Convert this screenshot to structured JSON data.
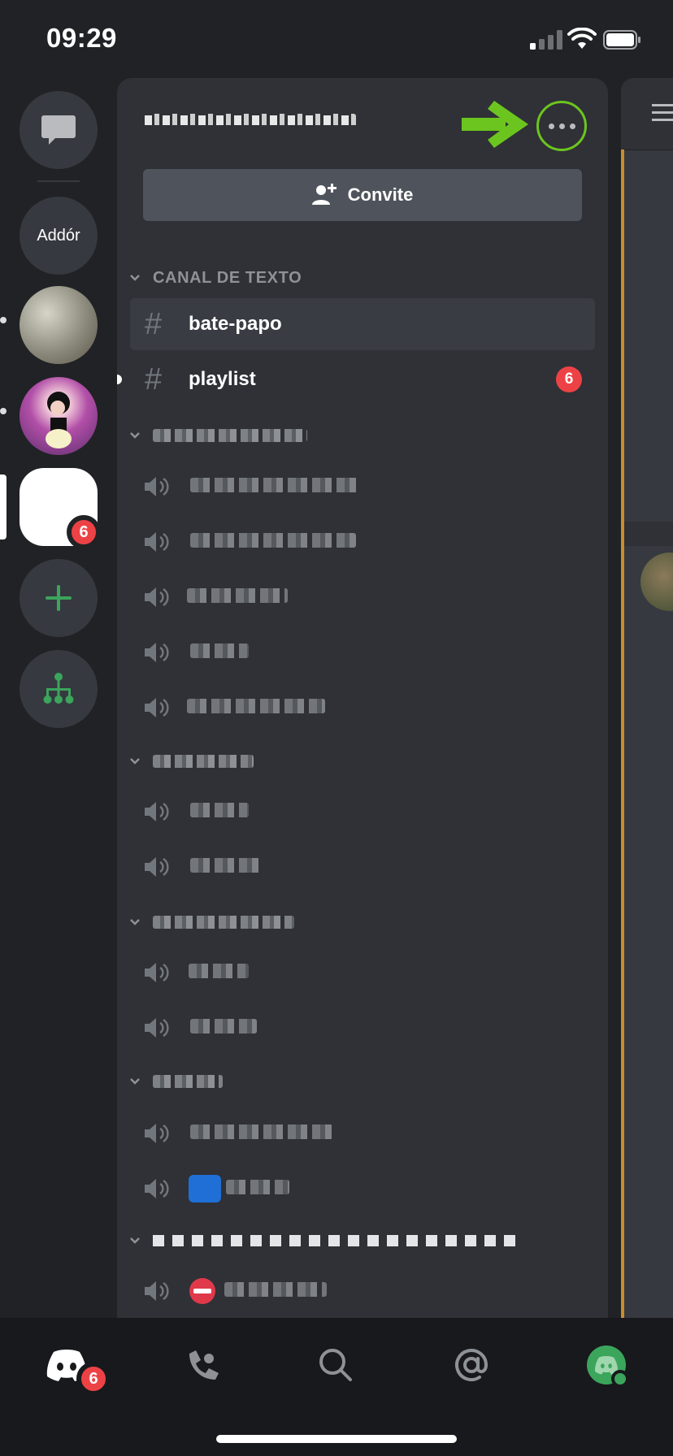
{
  "status_bar": {
    "time": "09:29"
  },
  "rail": {
    "folder_label": "Addór",
    "server_badge": "6",
    "add_server_icon": "plus-icon",
    "discover_icon": "hub-icon"
  },
  "panel": {
    "invite_label": "Convite",
    "categories": [
      {
        "name": "CANAL DE TEXTO"
      },
      {
        "name": ""
      },
      {
        "name": ""
      },
      {
        "name": ""
      },
      {
        "name": ""
      },
      {
        "name": ""
      }
    ],
    "text_channels": [
      {
        "name": "bate-papo",
        "selected": true
      },
      {
        "name": "playlist",
        "badge": "6",
        "unread": true
      }
    ]
  },
  "bottom_nav": {
    "home_badge": "6",
    "items": [
      "home-icon",
      "friends-icon",
      "search-icon",
      "mentions-icon",
      "profile-avatar"
    ]
  },
  "colors": {
    "accent_green": "#6cc51f",
    "badge_red": "#ed4245",
    "brand_green": "#3ba55c"
  }
}
